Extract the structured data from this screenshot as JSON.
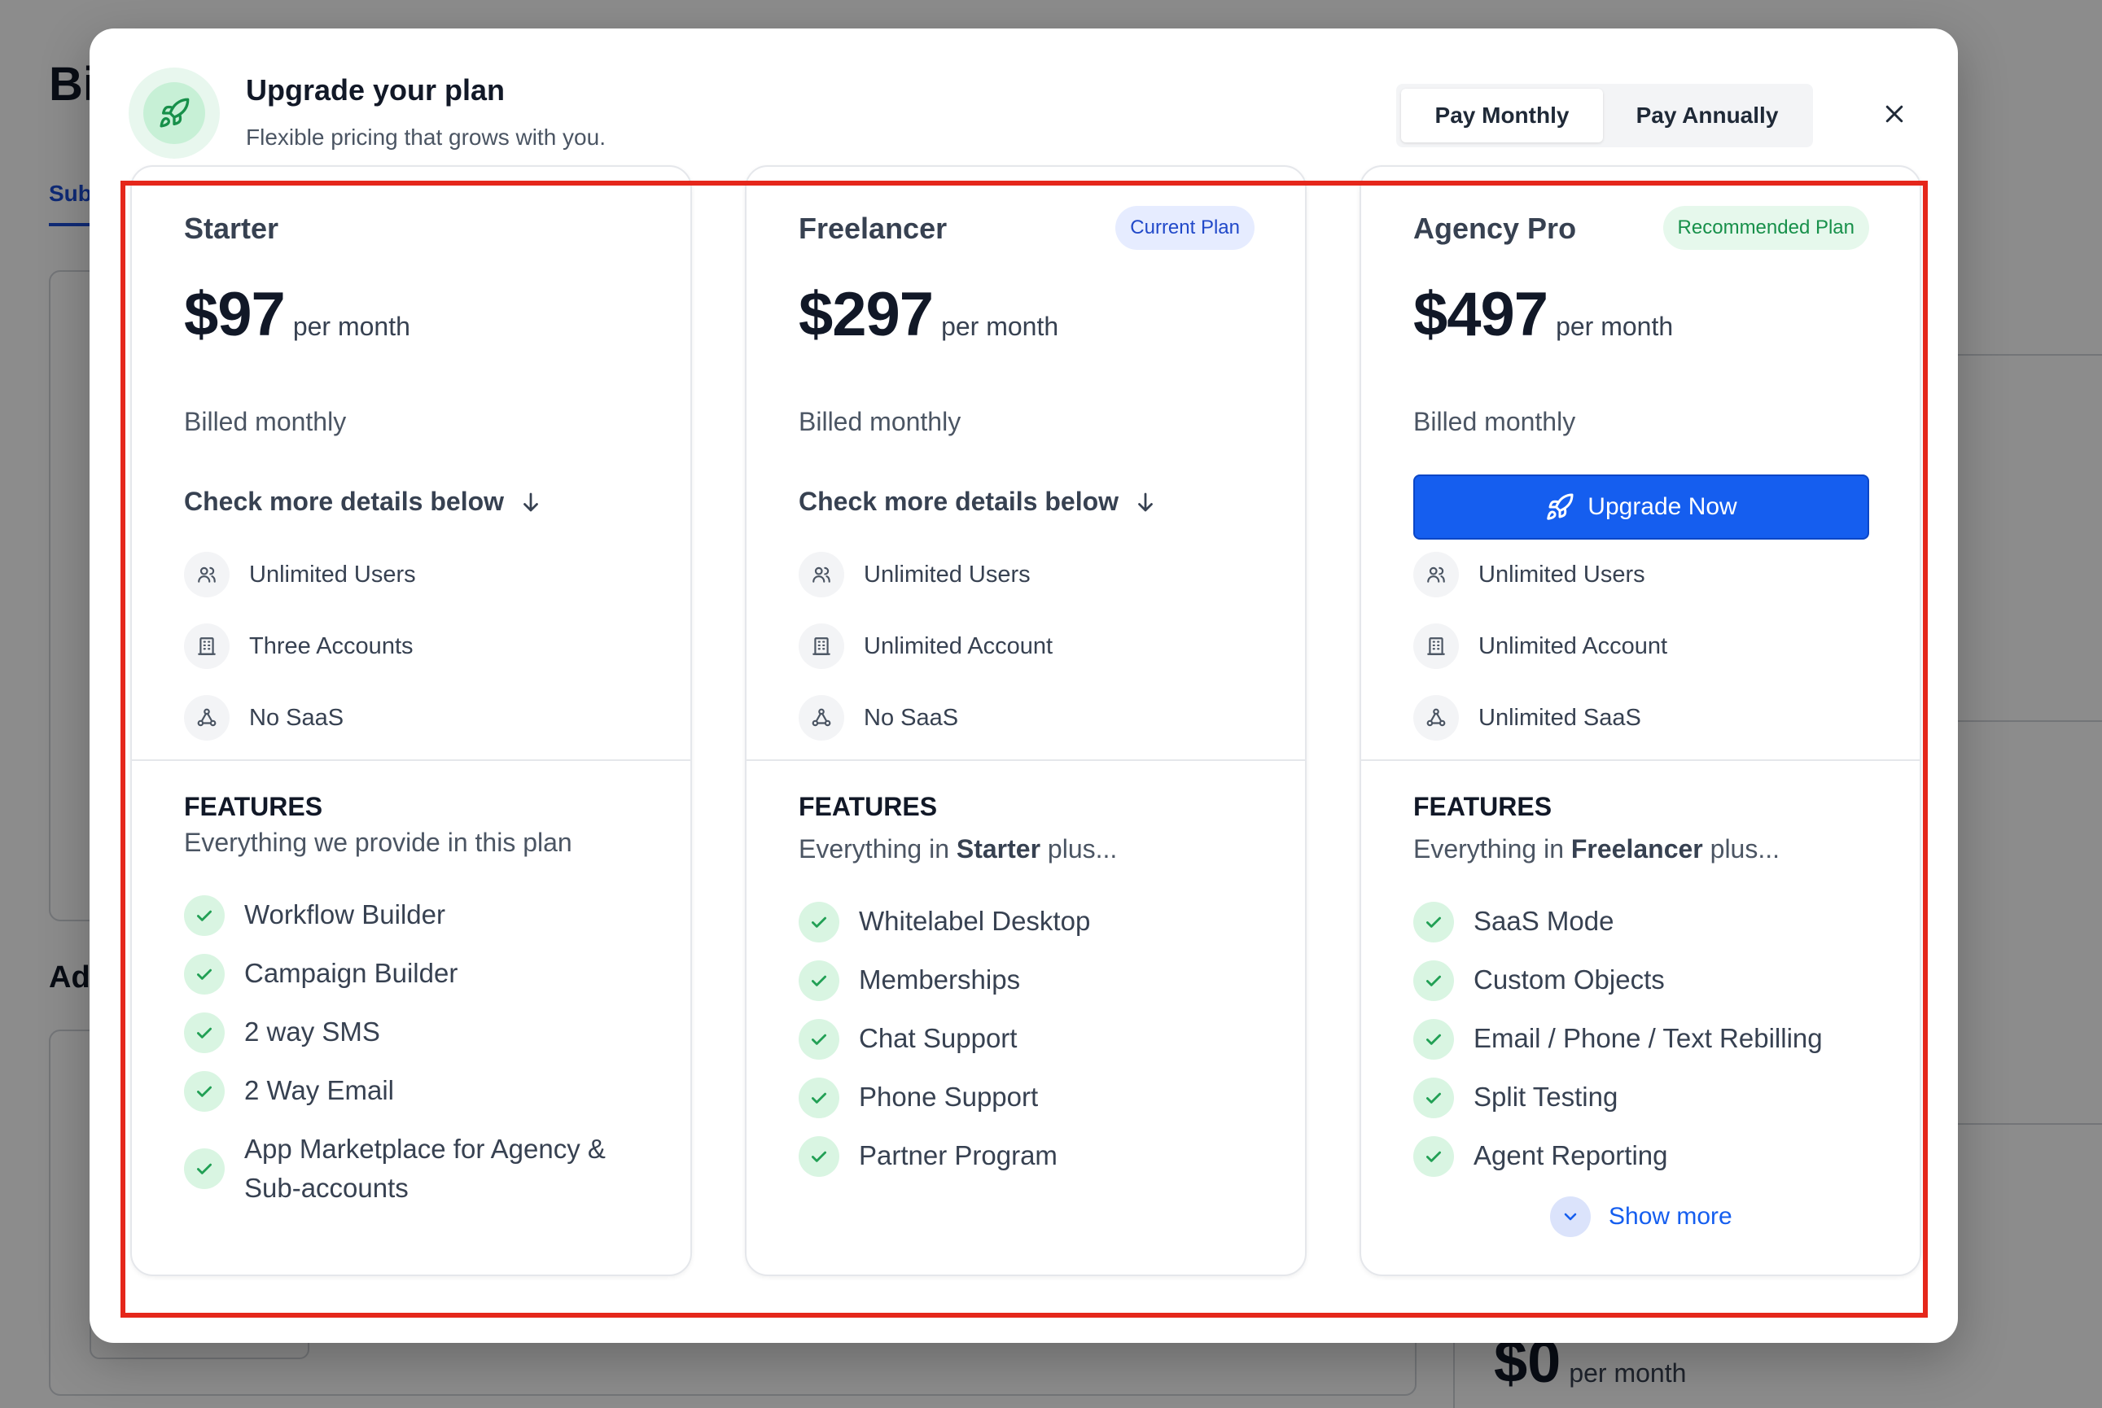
{
  "background": {
    "title_partial": "Bi",
    "tab_partial": "Sub",
    "section_partial": "Ad",
    "price_amount": "$0",
    "price_per": "per month"
  },
  "modal": {
    "title": "Upgrade your plan",
    "subtitle": "Flexible pricing that grows with you.",
    "header_icon": "rocket-icon",
    "billing_toggle": {
      "options": [
        "Pay Monthly",
        "Pay Annually"
      ],
      "selected": "Pay Monthly"
    },
    "close_icon": "close-icon"
  },
  "plans": [
    {
      "name": "Starter",
      "badge": "",
      "price": "$97",
      "per": "per month",
      "billed": "Billed monthly",
      "cta": "Check more details below",
      "stats": [
        {
          "icon": "users-icon",
          "label": "Unlimited Users"
        },
        {
          "icon": "building-icon",
          "label": "Three Accounts"
        },
        {
          "icon": "saas-icon",
          "label": "No SaaS"
        }
      ],
      "features_heading": "FEATURES",
      "features_sub": "Everything we provide in this plan",
      "features": [
        "Workflow Builder",
        "Campaign Builder",
        "2 way SMS",
        "2 Way Email",
        "App Marketplace for Agency & Sub-accounts"
      ]
    },
    {
      "name": "Freelancer",
      "badge": "Current Plan",
      "price": "$297",
      "per": "per month",
      "billed": "Billed monthly",
      "cta": "Check more details below",
      "stats": [
        {
          "icon": "users-icon",
          "label": "Unlimited Users"
        },
        {
          "icon": "building-icon",
          "label": "Unlimited Account"
        },
        {
          "icon": "saas-icon",
          "label": "No SaaS"
        }
      ],
      "features_heading": "FEATURES",
      "features_sub_pre": "Everything in ",
      "features_sub_bold": "Starter",
      "features_sub_post": " plus...",
      "features": [
        "Whitelabel Desktop",
        "Memberships",
        "Chat Support",
        "Phone Support",
        "Partner Program"
      ]
    },
    {
      "name": "Agency Pro",
      "badge": "Recommended Plan",
      "price": "$497",
      "per": "per month",
      "billed": "Billed monthly",
      "cta": "Upgrade Now",
      "stats": [
        {
          "icon": "users-icon",
          "label": "Unlimited Users"
        },
        {
          "icon": "building-icon",
          "label": "Unlimited Account"
        },
        {
          "icon": "saas-icon",
          "label": "Unlimited SaaS"
        }
      ],
      "features_heading": "FEATURES",
      "features_sub_pre": "Everything in ",
      "features_sub_bold": "Freelancer",
      "features_sub_post": " plus...",
      "features": [
        "SaaS Mode",
        "Custom Objects",
        "Email / Phone / Text Rebilling",
        "Split Testing",
        "Agent Reporting"
      ],
      "show_more": "Show more"
    }
  ],
  "colors": {
    "accent": "#155eef",
    "highlight_border": "#e5271b",
    "check_bg": "#d9f5e2",
    "check_fg": "#22a055"
  }
}
